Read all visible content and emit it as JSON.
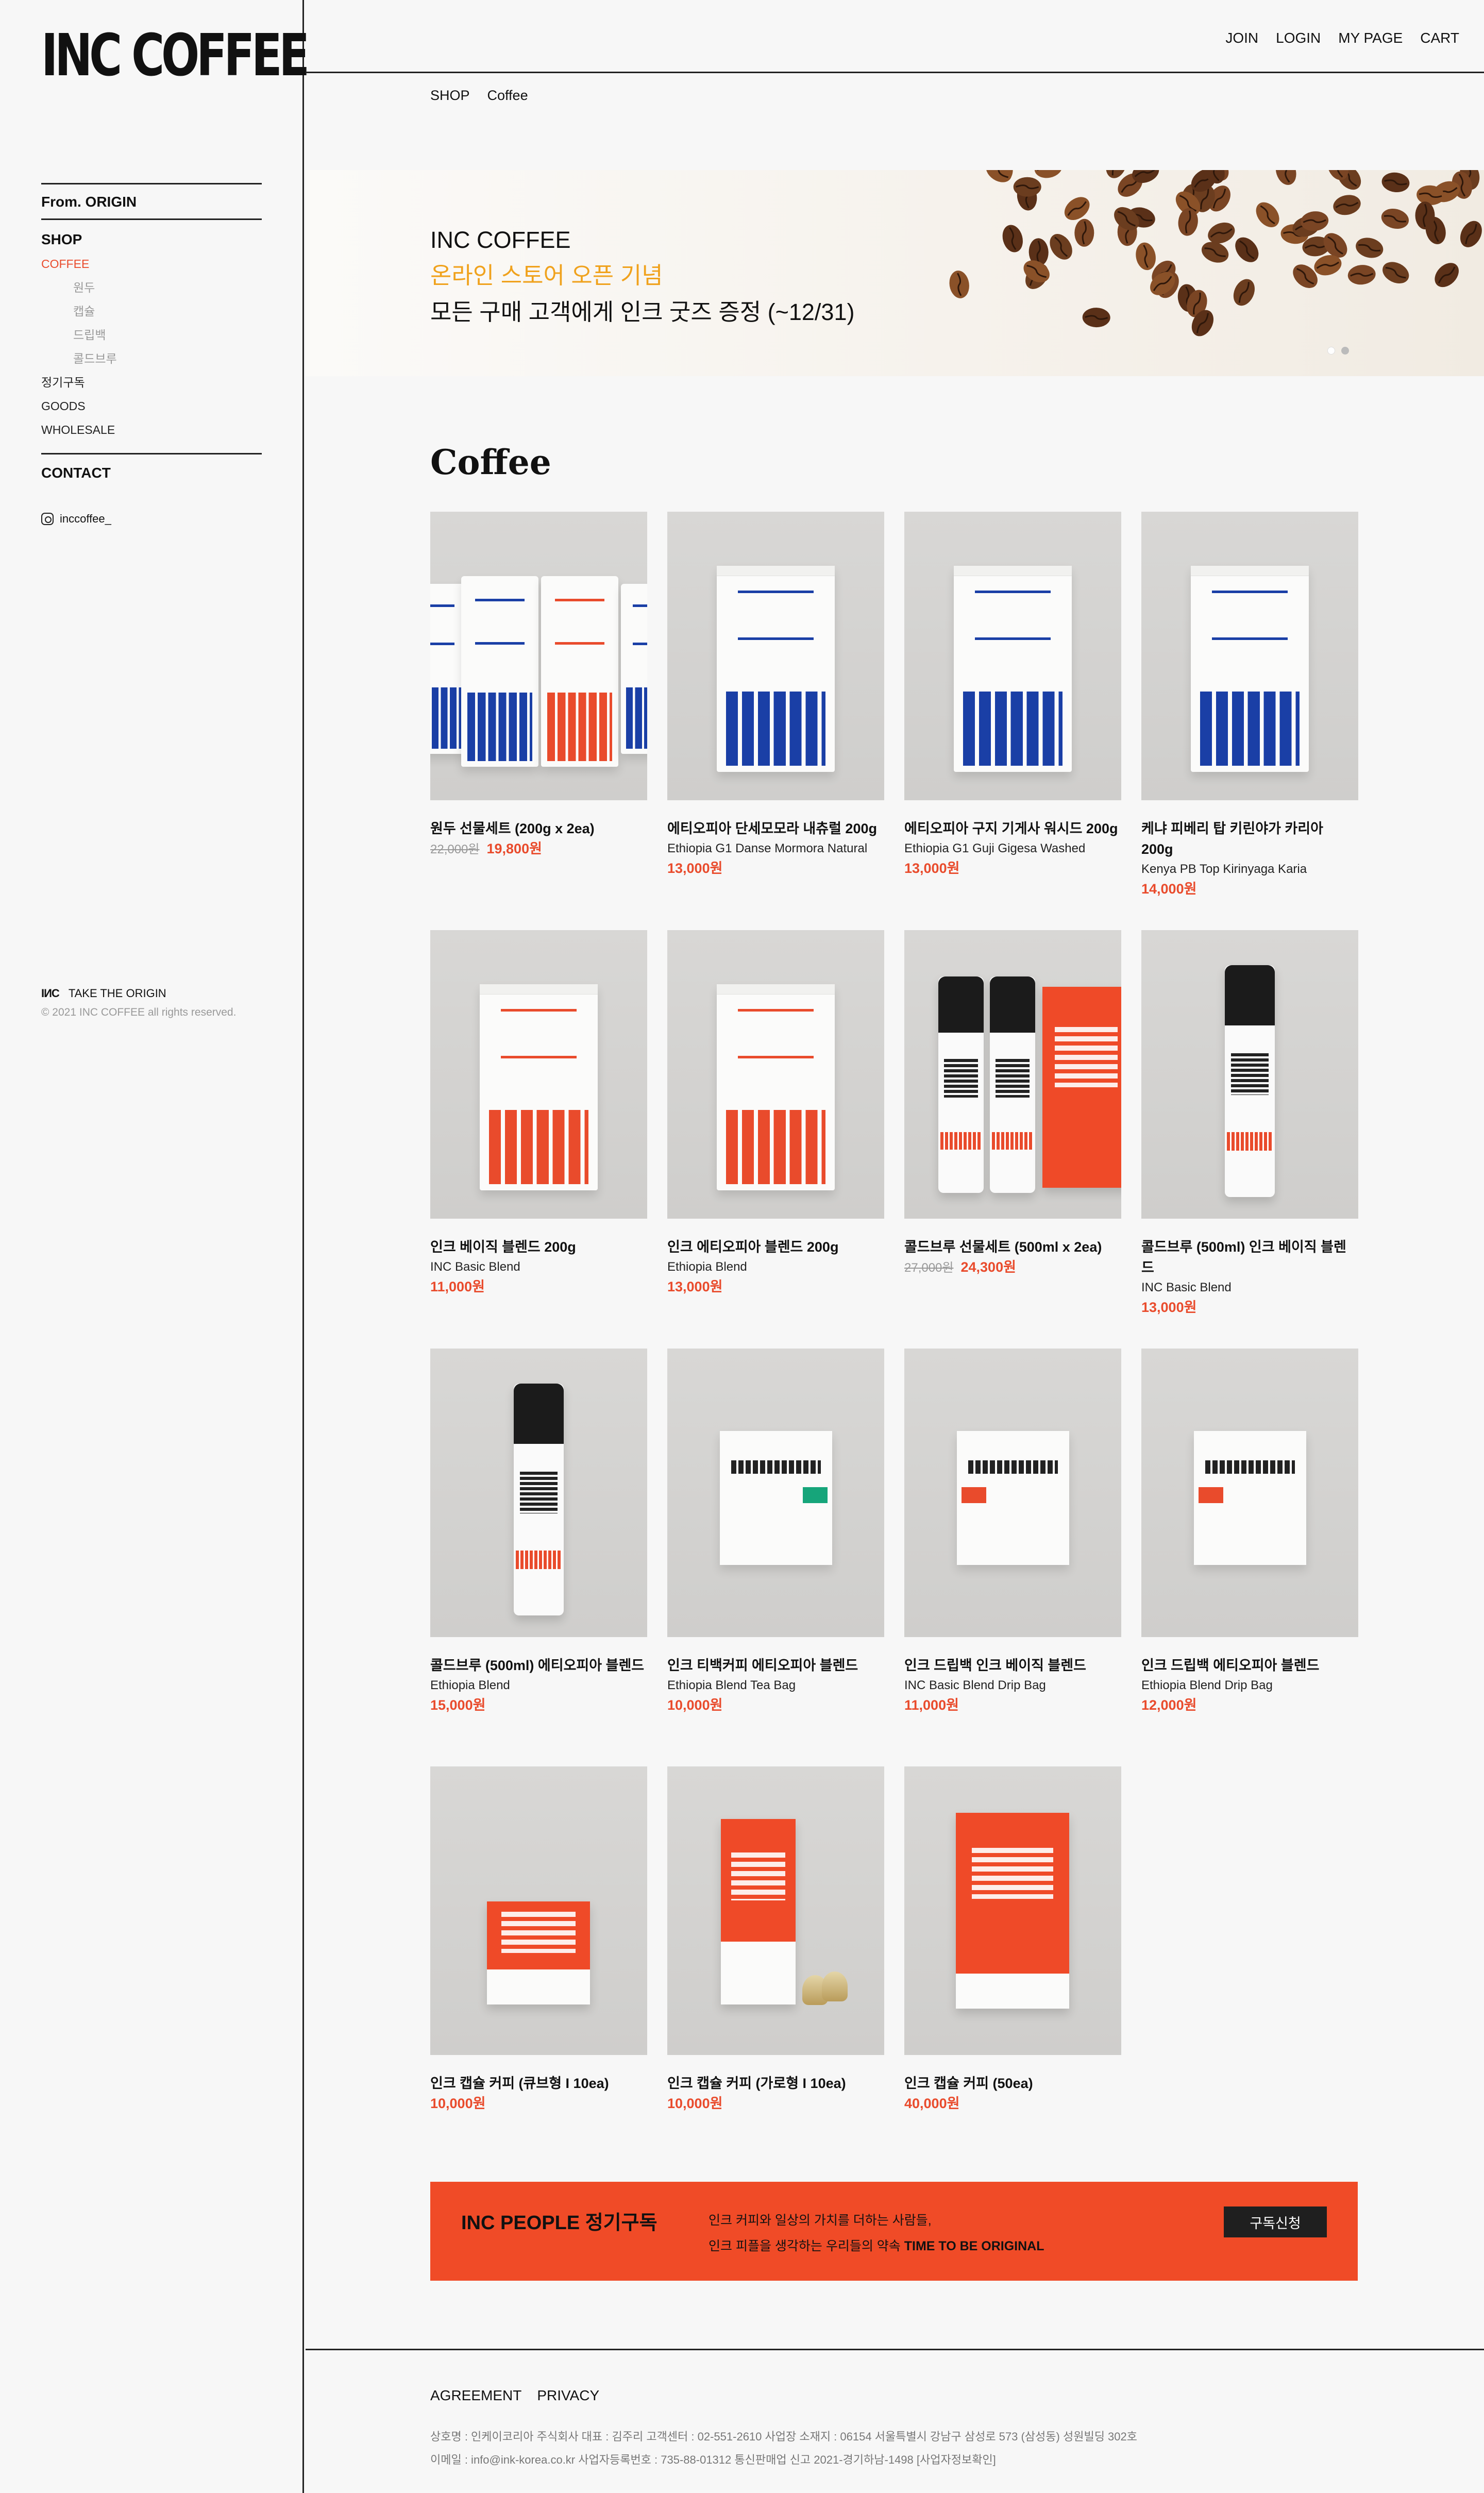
{
  "brand": {
    "logo": "INC COFFEE"
  },
  "sidebar": {
    "origin": "From. ORIGIN",
    "shop": "SHOP",
    "items": [
      {
        "label": "COFFEE",
        "level": 1,
        "active": true
      },
      {
        "label": "원두",
        "level": 2
      },
      {
        "label": "캡슐",
        "level": 2
      },
      {
        "label": "드립백",
        "level": 2
      },
      {
        "label": "콜드브루",
        "level": 2
      },
      {
        "label": "정기구독",
        "level": 1
      },
      {
        "label": "GOODS",
        "level": 1
      },
      {
        "label": "WHOLESALE",
        "level": 1
      }
    ],
    "contact": "CONTACT",
    "instagram": "inccoffee_",
    "footer_mark": "ІИC",
    "footer_tagline": "TAKE THE ORIGIN",
    "copyright": "© 2021 INC COFFEE all rights reserved."
  },
  "header": {
    "links": [
      "JOIN",
      "LOGIN",
      "MY PAGE",
      "CART"
    ]
  },
  "breadcrumb": [
    "SHOP",
    "Coffee"
  ],
  "banner": {
    "title": "INC COFFEE",
    "line1": "온라인 스토어 오픈 기념",
    "line2": "모든 구매 고객에게 인크 굿즈 증정 (~12/31)",
    "slide_count": 2,
    "active_slide": 1
  },
  "section_title": "Coffee",
  "products": [
    {
      "name": "원두 선물세트 (200g x 2ea)",
      "sub": "",
      "old_price": "22,000원",
      "price": "19,800원",
      "visual": "bags-set"
    },
    {
      "name": "에티오피아 단세모모라 내츄럴 200g",
      "sub": "Ethiopia G1 Danse Mormora Natural",
      "old_price": "",
      "price": "13,000원",
      "visual": "bag-blue"
    },
    {
      "name": "에티오피아 구지 기게사 워시드 200g",
      "sub": "Ethiopia G1 Guji Gigesa Washed",
      "old_price": "",
      "price": "13,000원",
      "visual": "bag-blue"
    },
    {
      "name": "케냐 피베리 탑 키린야가 카리아 200g",
      "sub": "Kenya PB Top Kirinyaga Karia",
      "old_price": "",
      "price": "14,000원",
      "visual": "bag-blue"
    },
    {
      "name": "인크 베이직 블렌드 200g",
      "sub": "INC Basic Blend",
      "old_price": "",
      "price": "11,000원",
      "visual": "bag-red"
    },
    {
      "name": "인크 에티오피아 블렌드 200g",
      "sub": "Ethiopia Blend",
      "old_price": "",
      "price": "13,000원",
      "visual": "bag-red"
    },
    {
      "name": "콜드브루 선물세트 (500ml x 2ea)",
      "sub": "",
      "old_price": "27,000원",
      "price": "24,300원",
      "visual": "coldbrew-set"
    },
    {
      "name": "콜드브루 (500ml) 인크 베이직 블렌드",
      "sub": "INC Basic Blend",
      "old_price": "",
      "price": "13,000원",
      "visual": "bottle"
    },
    {
      "name": "콜드브루 (500ml) 에티오피아 블렌드",
      "sub": "Ethiopia Blend",
      "old_price": "",
      "price": "15,000원",
      "visual": "bottle"
    },
    {
      "name": "인크 티백커피 에티오피아 블렌드",
      "sub": "Ethiopia Blend Tea Bag",
      "old_price": "",
      "price": "10,000원",
      "visual": "box-green"
    },
    {
      "name": "인크 드립백 인크 베이직 블렌드",
      "sub": "INC Basic Blend Drip Bag",
      "old_price": "",
      "price": "11,000원",
      "visual": "box-red"
    },
    {
      "name": "인크 드립백 에티오피아 블렌드",
      "sub": "Ethiopia Blend Drip Bag",
      "old_price": "",
      "price": "12,000원",
      "visual": "box-red"
    },
    {
      "name": "인크 캡슐 커피 (큐브형 I 10ea)",
      "sub": "",
      "old_price": "",
      "price": "10,000원",
      "visual": "capsule-cube"
    },
    {
      "name": "인크 캡슐 커피 (가로형 I 10ea)",
      "sub": "",
      "old_price": "",
      "price": "10,000원",
      "visual": "capsule-tall"
    },
    {
      "name": "인크 캡슐 커피 (50ea)",
      "sub": "",
      "old_price": "",
      "price": "40,000원",
      "visual": "capsule-big"
    }
  ],
  "subscription": {
    "title": "INC PEOPLE 정기구독",
    "line1": "인크 커피와 일상의 가치를 더하는 사람들,",
    "line2_prefix": "인크 피플을 생각하는 우리들의 약속 ",
    "line2_bold": "TIME TO BE ORIGINAL",
    "button": "구독신청"
  },
  "footer": {
    "links": [
      "AGREEMENT",
      "PRIVACY"
    ],
    "info1": "상호명 : 인케이코리아 주식회사 대표 : 김주리 고객센터 : 02-551-2610 사업장 소재지 : 06154 서울특별시 강남구 삼성로 573 (삼성동) 성원빌딩 302호",
    "info2": "이메일 : info@ink-korea.co.kr 사업자등록번호 : 735-88-01312 통신판매업 신고 2021-경기하남-1498 [사업자정보확인]"
  },
  "colors": {
    "accent": "#e94b2c",
    "banner_highlight": "#f0a21d",
    "subscription_bg": "#f04b27",
    "bag_blue": "#1a3fa6"
  }
}
